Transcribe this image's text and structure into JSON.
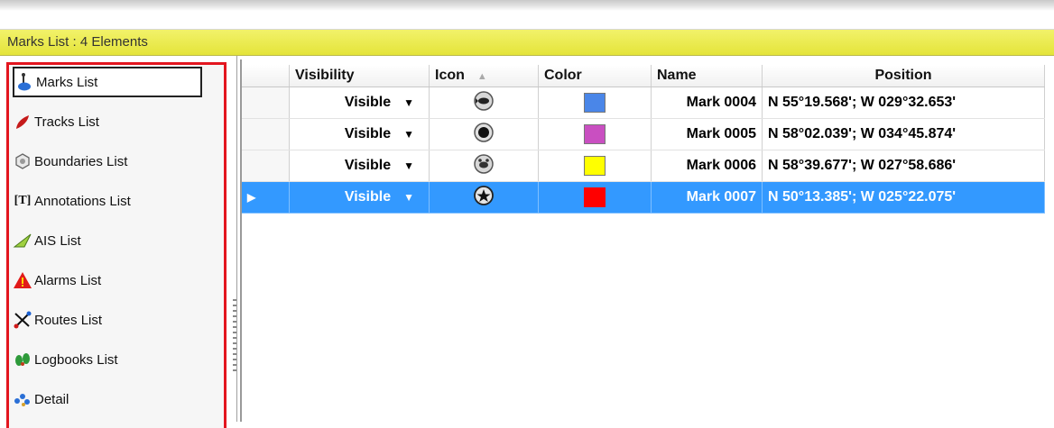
{
  "window": {
    "title": "Marks List : 4 Elements"
  },
  "sidebar": {
    "items": [
      {
        "label": "Marks List",
        "icon": "marks-pin-icon",
        "selected": true
      },
      {
        "label": "Tracks List",
        "icon": "tracks-icon"
      },
      {
        "label": "Boundaries List",
        "icon": "boundaries-icon"
      },
      {
        "label": "Annotations List",
        "icon": "annotations-icon",
        "icon_text": "[T]"
      },
      {
        "label": "AIS List",
        "icon": "ais-icon"
      },
      {
        "label": "Alarms List",
        "icon": "alarm-warning-icon"
      },
      {
        "label": "Routes List",
        "icon": "routes-icon"
      },
      {
        "label": "Logbooks List",
        "icon": "logbooks-icon"
      },
      {
        "label": "Detail",
        "icon": "detail-icon"
      }
    ]
  },
  "grid": {
    "columns": {
      "visibility": "Visibility",
      "icon": "Icon",
      "color": "Color",
      "name": "Name",
      "position": "Position"
    },
    "rows": [
      {
        "visibility": "Visible",
        "icon": "fish-mark-icon",
        "color": "#4a86e8",
        "name": "Mark 0004",
        "position": "N 55°19.568'; W 029°32.653'"
      },
      {
        "visibility": "Visible",
        "icon": "dot-mark-icon",
        "color": "#c94fc1",
        "name": "Mark 0005",
        "position": "N 58°02.039'; W 034°45.874'"
      },
      {
        "visibility": "Visible",
        "icon": "crab-mark-icon",
        "color": "#ffff00",
        "name": "Mark 0006",
        "position": "N 58°39.677'; W 027°58.686'"
      },
      {
        "visibility": "Visible",
        "icon": "star-mark-icon",
        "color": "#ff0000",
        "name": "Mark 0007",
        "position": "N 50°13.385'; W 025°22.075'",
        "selected": true
      }
    ]
  },
  "colors": {
    "highlight": "#3399ff",
    "titlebar": "#e8e84a",
    "nav_border": "#e3161f"
  }
}
